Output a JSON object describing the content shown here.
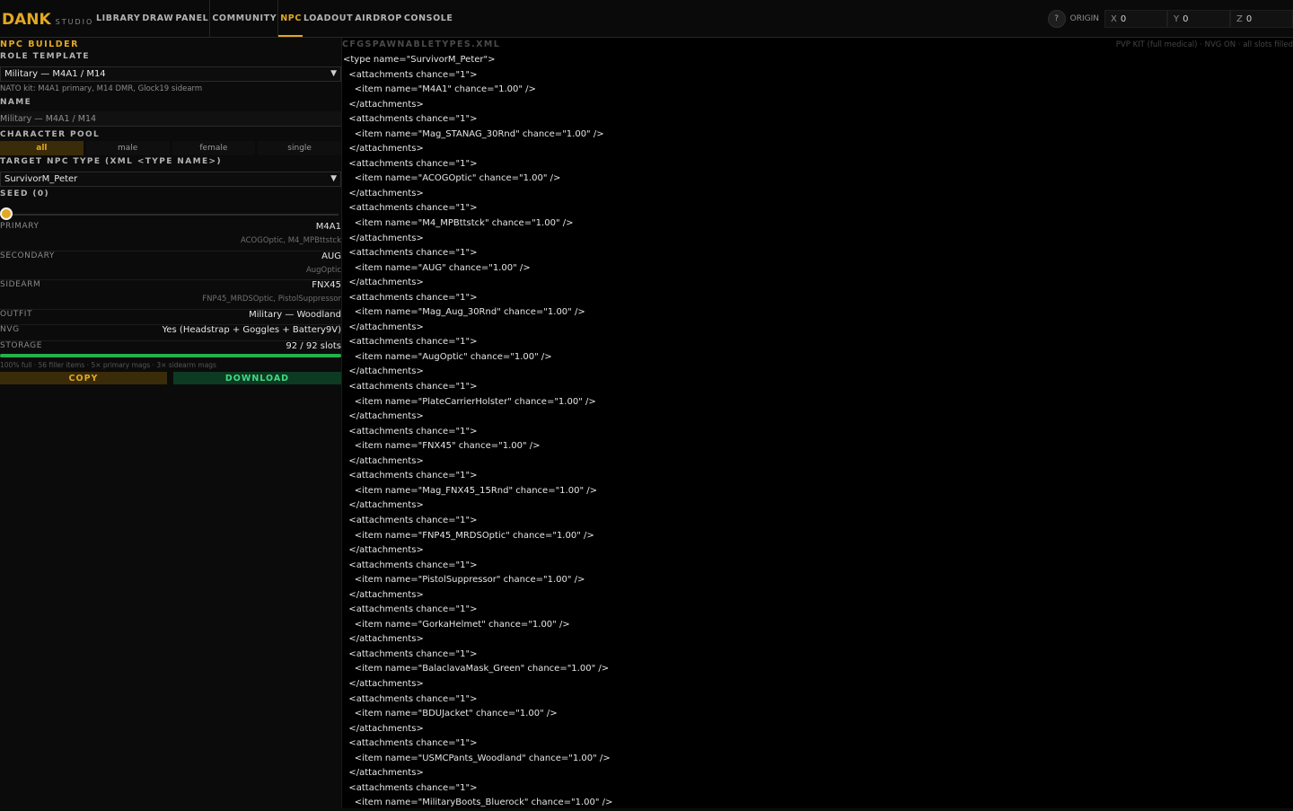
{
  "brand": {
    "name": "DANK",
    "sub": "STUDIO"
  },
  "nav": [
    {
      "label": "LIBRARY",
      "active": false
    },
    {
      "label": "DRAW",
      "active": false
    },
    {
      "label": "PANEL",
      "active": false
    },
    {
      "label": "COMMUNITY",
      "active": false
    },
    {
      "label": "NPC",
      "active": true
    },
    {
      "label": "LOADOUT",
      "active": false
    },
    {
      "label": "AIRDROP",
      "active": false
    },
    {
      "label": "CONSOLE",
      "active": false
    }
  ],
  "origin": {
    "help": "?",
    "label": "ORIGIN",
    "x_axis": "X",
    "x": "0",
    "y_axis": "Y",
    "y": "0",
    "z_axis": "Z",
    "z": "0"
  },
  "sidebar": {
    "title": "NPC BUILDER",
    "role_label": "ROLE TEMPLATE",
    "role_value": "Military — M4A1 / M14",
    "role_hint": "NATO kit: M4A1 primary, M14 DMR, Glock19 sidearm",
    "name_label": "NAME",
    "name_placeholder": "Military — M4A1 / M14",
    "pool_label": "CHARACTER POOL",
    "pool_options": [
      "all",
      "male",
      "female",
      "single"
    ],
    "target_label": "TARGET NPC TYPE (XML <TYPE NAME>)",
    "target_value": "SurvivorM_Peter",
    "seed_label": "SEED (0)",
    "seed_value": 0,
    "rows": [
      {
        "label": "PRIMARY",
        "value": "M4A1",
        "sub": "ACOGOptic, M4_MPBttstck"
      },
      {
        "label": "SECONDARY",
        "value": "AUG",
        "sub": "AugOptic"
      },
      {
        "label": "SIDEARM",
        "value": "FNX45",
        "sub": "FNP45_MRDSOptic, PistolSuppressor"
      },
      {
        "label": "OUTFIT",
        "value": "Military — Woodland",
        "sub": ""
      },
      {
        "label": "NVG",
        "value": "Yes (Headstrap + Goggles + Battery9V)",
        "sub": ""
      },
      {
        "label": "STORAGE",
        "value": "92 / 92 slots",
        "sub": ""
      }
    ],
    "storage_fill": 1.0,
    "storage_hint": "100% full · 56 filler items · 5× primary mags · 3× sidearm mags",
    "copy_label": "COPY",
    "download_label": "DOWNLOAD"
  },
  "main": {
    "file_title": "CFGSPAWNABLETYPES.XML",
    "file_meta": "PVP KIT (full medical) · NVG ON · all slots filled",
    "code_lines": [
      "<type name=\"SurvivorM_Peter\">",
      "  <attachments chance=\"1\">",
      "    <item name=\"M4A1\" chance=\"1.00\" />",
      "  </attachments>",
      "  <attachments chance=\"1\">",
      "    <item name=\"Mag_STANAG_30Rnd\" chance=\"1.00\" />",
      "  </attachments>",
      "  <attachments chance=\"1\">",
      "    <item name=\"ACOGOptic\" chance=\"1.00\" />",
      "  </attachments>",
      "  <attachments chance=\"1\">",
      "    <item name=\"M4_MPBttstck\" chance=\"1.00\" />",
      "  </attachments>",
      "  <attachments chance=\"1\">",
      "    <item name=\"AUG\" chance=\"1.00\" />",
      "  </attachments>",
      "  <attachments chance=\"1\">",
      "    <item name=\"Mag_Aug_30Rnd\" chance=\"1.00\" />",
      "  </attachments>",
      "  <attachments chance=\"1\">",
      "    <item name=\"AugOptic\" chance=\"1.00\" />",
      "  </attachments>",
      "  <attachments chance=\"1\">",
      "    <item name=\"PlateCarrierHolster\" chance=\"1.00\" />",
      "  </attachments>",
      "  <attachments chance=\"1\">",
      "    <item name=\"FNX45\" chance=\"1.00\" />",
      "  </attachments>",
      "  <attachments chance=\"1\">",
      "    <item name=\"Mag_FNX45_15Rnd\" chance=\"1.00\" />",
      "  </attachments>",
      "  <attachments chance=\"1\">",
      "    <item name=\"FNP45_MRDSOptic\" chance=\"1.00\" />",
      "  </attachments>",
      "  <attachments chance=\"1\">",
      "    <item name=\"PistolSuppressor\" chance=\"1.00\" />",
      "  </attachments>",
      "  <attachments chance=\"1\">",
      "    <item name=\"GorkaHelmet\" chance=\"1.00\" />",
      "  </attachments>",
      "  <attachments chance=\"1\">",
      "    <item name=\"BalaclavaMask_Green\" chance=\"1.00\" />",
      "  </attachments>",
      "  <attachments chance=\"1\">",
      "    <item name=\"BDUJacket\" chance=\"1.00\" />",
      "  </attachments>",
      "  <attachments chance=\"1\">",
      "    <item name=\"USMCPants_Woodland\" chance=\"1.00\" />",
      "  </attachments>",
      "  <attachments chance=\"1\">",
      "    <item name=\"MilitaryBoots_Bluerock\" chance=\"1.00\" />"
    ]
  },
  "colors": {
    "accent": "#e3a822",
    "success": "#22b14c"
  }
}
